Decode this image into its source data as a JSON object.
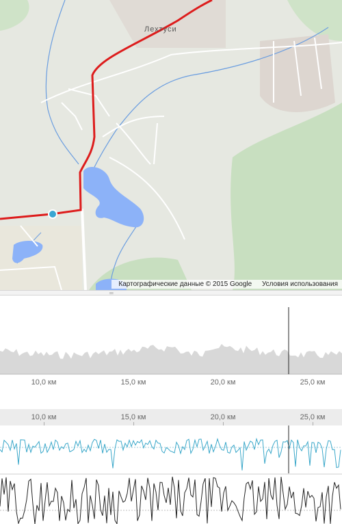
{
  "map": {
    "town_label": "Лехтуси",
    "attribution": "Картографические данные © 2015 Google",
    "terms_link": "Условия использования",
    "colors": {
      "route": "#dd1c1c",
      "water": "#8cb2f8",
      "forest": "#c8dfc0",
      "marker": "#3aa6d2"
    }
  },
  "elevation_chart": {
    "axis_ticks": [
      "10,0 км",
      "15,0 км",
      "20,0 км",
      "25,0 км"
    ]
  },
  "detail_chart": {
    "axis_ticks": [
      "10,0 км",
      "15,0 км",
      "20,0 км",
      "25,0 км"
    ]
  },
  "splitter": {
    "icon": "grip-icon"
  }
}
